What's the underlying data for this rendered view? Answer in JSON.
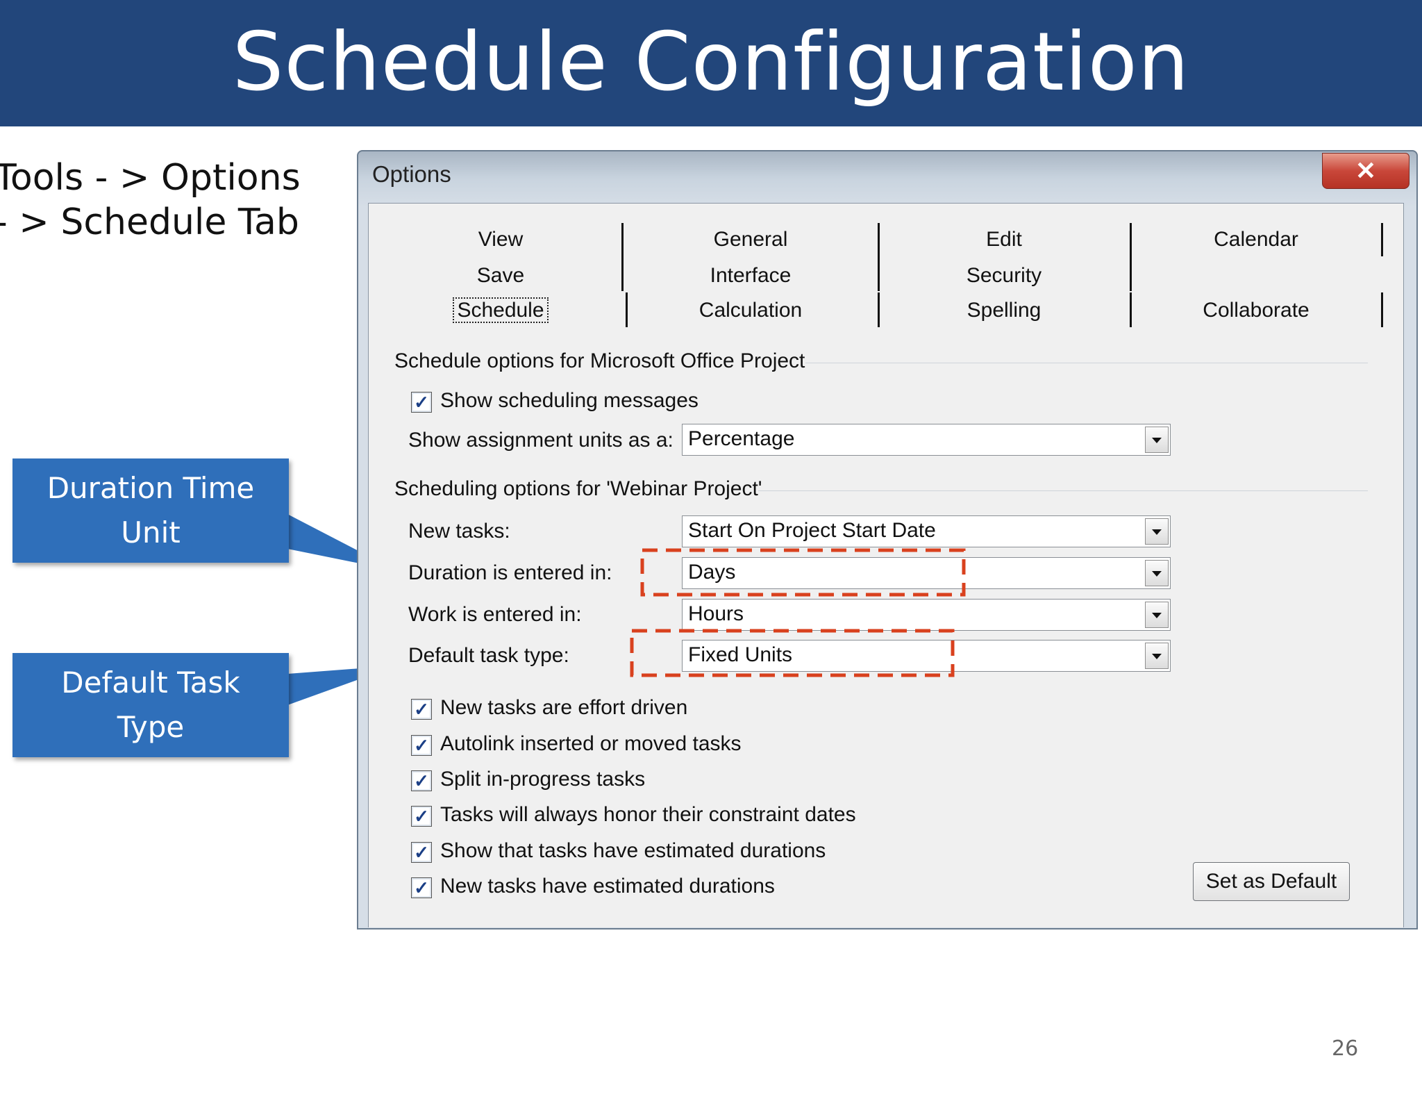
{
  "slide": {
    "title": "Schedule Configuration",
    "instructions": [
      "Tools - > Options",
      "- > Schedule Tab"
    ],
    "callouts": [
      "Duration Time Unit",
      "Default Task Type"
    ],
    "page_number": "26"
  },
  "dialog": {
    "title": "Options",
    "close_icon": "close-icon",
    "tabs": {
      "row1": [
        "View",
        "General",
        "Edit",
        "Calendar"
      ],
      "row2": [
        "Save",
        "Interface",
        "Security",
        ""
      ],
      "row3": [
        "Schedule",
        "Calculation",
        "Spelling",
        "Collaborate"
      ],
      "active": "Schedule"
    },
    "group1": {
      "title": "Schedule options for Microsoft Office Project",
      "show_scheduling_messages": {
        "label": "Show scheduling messages",
        "checked": true
      },
      "assignment_units": {
        "label": "Show assignment units as a:",
        "value": "Percentage"
      }
    },
    "group2": {
      "title": "Scheduling options for 'Webinar Project'",
      "new_tasks": {
        "label": "New tasks:",
        "value": "Start On Project Start Date"
      },
      "duration": {
        "label": "Duration is entered in:",
        "value": "Days"
      },
      "work": {
        "label": "Work is entered in:",
        "value": "Hours"
      },
      "task_type": {
        "label": "Default task type:",
        "value": "Fixed Units"
      },
      "checkboxes": [
        {
          "label": "New tasks are effort driven",
          "checked": true
        },
        {
          "label": "Autolink inserted or moved tasks",
          "checked": true
        },
        {
          "label": "Split in-progress tasks",
          "checked": true
        },
        {
          "label": "Tasks will always honor their constraint dates",
          "checked": true
        },
        {
          "label": "Show that tasks have estimated durations",
          "checked": true
        },
        {
          "label": "New tasks have estimated durations",
          "checked": true
        }
      ]
    },
    "set_default_label": "Set as Default"
  },
  "colors": {
    "title_band": "#22467b",
    "callout": "#2f6fba",
    "highlight": "#d9411e"
  }
}
